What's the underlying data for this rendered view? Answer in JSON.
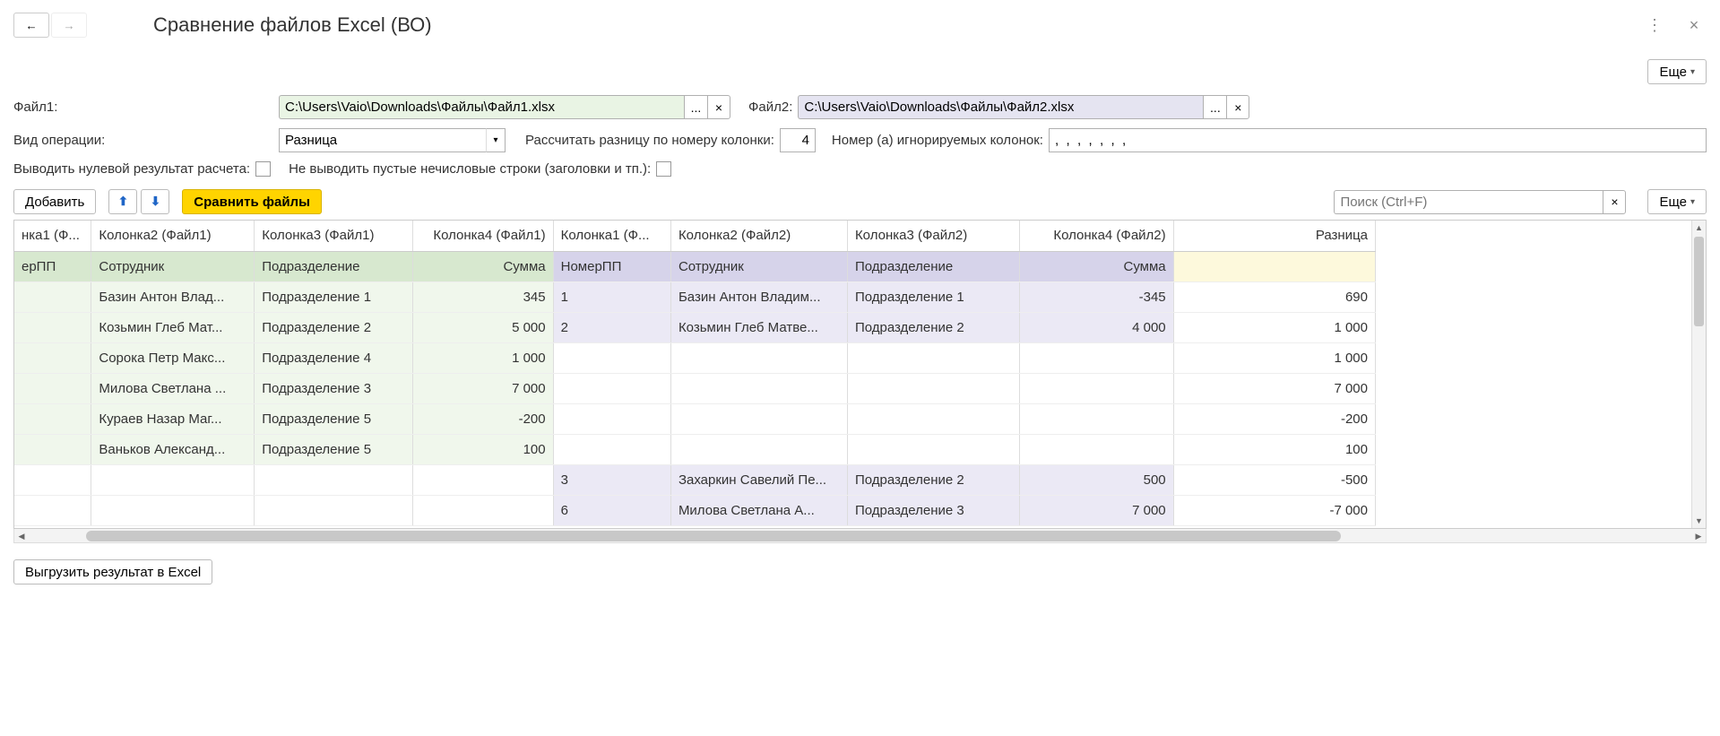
{
  "header": {
    "title": "Сравнение файлов Excel (ВО)"
  },
  "toolbar": {
    "more_label": "Еще"
  },
  "form": {
    "file1_label": "Файл1:",
    "file1_path": "C:\\Users\\Vaio\\Downloads\\Файлы\\Файл1.xlsx",
    "file2_label": "Файл2:",
    "file2_path": "C:\\Users\\Vaio\\Downloads\\Файлы\\Файл2.xlsx",
    "op_type_label": "Вид операции:",
    "op_type_value": "Разница",
    "calc_by_col_label": "Рассчитать разницу по номеру колонки:",
    "calc_by_col_value": "4",
    "ignored_cols_label": "Номер (а) игнорируемых колонок:",
    "ignored_cols_value": ",  ,  ,  ,  ,  ,  ,",
    "print_zero_label": "Выводить нулевой результат расчета:",
    "skip_empty_label": "Не выводить пустые нечисловые строки (заголовки и тп.):"
  },
  "tbl_toolbar": {
    "add_label": "Добавить",
    "compare_label": "Сравнить файлы",
    "search_placeholder": "Поиск (Ctrl+F)",
    "more_label": "Еще"
  },
  "grid": {
    "headers": {
      "c1": "нка1 (Ф...",
      "c2": "Колонка2 (Файл1)",
      "c3": "Колонка3 (Файл1)",
      "c4": "Колонка4 (Файл1)",
      "c5": "Колонка1 (Ф...",
      "c6": "Колонка2 (Файл2)",
      "c7": "Колонка3 (Файл2)",
      "c8": "Колонка4 (Файл2)",
      "c9": "Разница"
    },
    "rows": [
      {
        "c1": "ерПП",
        "c2": "Сотрудник",
        "c3": "Подразделение",
        "c4": "Сумма",
        "c5": "НомерПП",
        "c6": "Сотрудник",
        "c7": "Подразделение",
        "c8": "Сумма",
        "c9": "",
        "kind": "subhdr"
      },
      {
        "c1": "",
        "c2": "Базин Антон Влад...",
        "c3": "Подразделение 1",
        "c4": "345",
        "c5": "1",
        "c6": "Базин Антон Владим...",
        "c7": "Подразделение 1",
        "c8": "-345",
        "c9": "690",
        "kind": "both"
      },
      {
        "c1": "",
        "c2": "Козьмин Глеб Мат...",
        "c3": "Подразделение 2",
        "c4": "5 000",
        "c5": "2",
        "c6": "Козьмин Глеб Матве...",
        "c7": "Подразделение 2",
        "c8": "4 000",
        "c9": "1 000",
        "kind": "both"
      },
      {
        "c1": "",
        "c2": "Сорока Петр Макс...",
        "c3": "Подразделение 4",
        "c4": "1 000",
        "c5": "",
        "c6": "",
        "c7": "",
        "c8": "",
        "c9": "1 000",
        "kind": "left"
      },
      {
        "c1": "",
        "c2": "Милова Светлана ...",
        "c3": "Подразделение 3",
        "c4": "7 000",
        "c5": "",
        "c6": "",
        "c7": "",
        "c8": "",
        "c9": "7 000",
        "kind": "left"
      },
      {
        "c1": "",
        "c2": "Кураев Назар Маг...",
        "c3": "Подразделение 5",
        "c4": "-200",
        "c5": "",
        "c6": "",
        "c7": "",
        "c8": "",
        "c9": "-200",
        "kind": "left"
      },
      {
        "c1": "",
        "c2": "Ваньков Александ...",
        "c3": "Подразделение 5",
        "c4": "100",
        "c5": "",
        "c6": "",
        "c7": "",
        "c8": "",
        "c9": "100",
        "kind": "left"
      },
      {
        "c1": "",
        "c2": "",
        "c3": "",
        "c4": "",
        "c5": "3",
        "c6": "Захаркин Савелий Пе...",
        "c7": "Подразделение 2",
        "c8": "500",
        "c9": "-500",
        "kind": "right"
      },
      {
        "c1": "",
        "c2": "",
        "c3": "",
        "c4": "",
        "c5": "6",
        "c6": "Милова Светлана А...",
        "c7": "Подразделение 3",
        "c8": "7 000",
        "c9": "-7 000",
        "kind": "right"
      }
    ]
  },
  "footer": {
    "export_label": "Выгрузить результат в Excel"
  },
  "glyphs": {
    "ellipsis": "...",
    "x": "×",
    "caret": "▾",
    "arrow_left": "←",
    "arrow_right": "→",
    "arrow_up": "⬆",
    "arrow_down": "⬇",
    "vdots": "⋮",
    "tri_up": "▲",
    "tri_down": "▼",
    "tri_left": "◀",
    "tri_right": "▶"
  }
}
